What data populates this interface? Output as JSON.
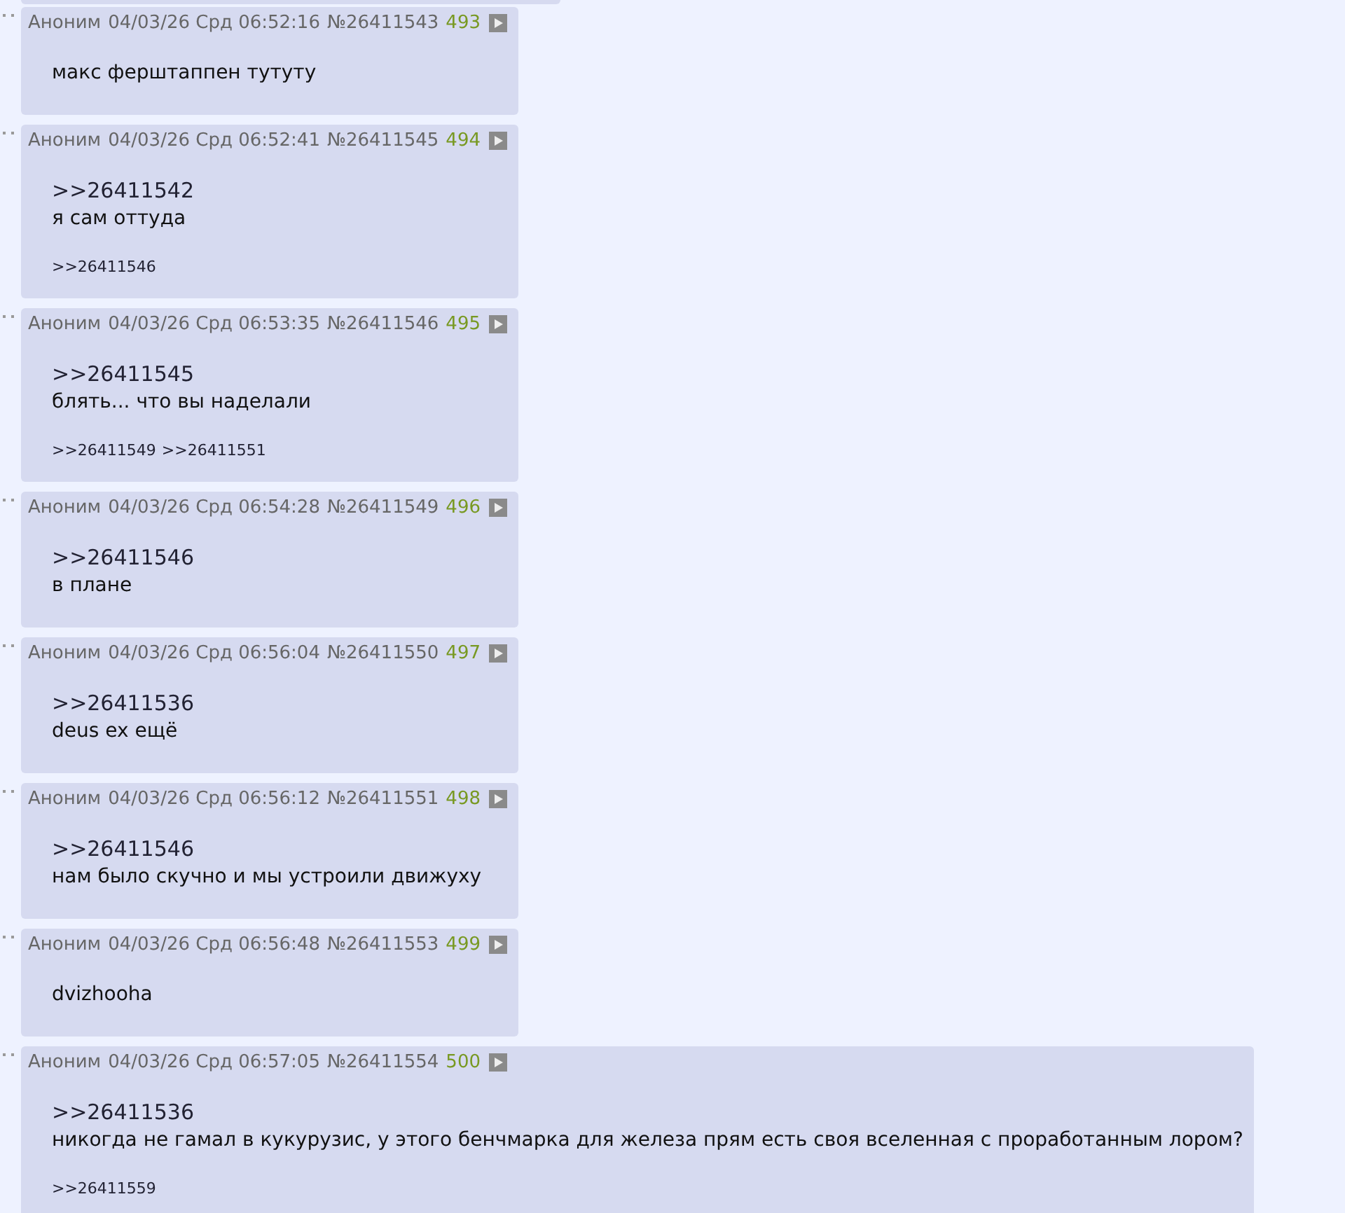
{
  "posts": [
    {
      "author": "Аноним",
      "date": "04/03/26 Срд 06:52:16",
      "number": "№26411543",
      "index": "493",
      "text": "макс ферштаппен тутуту"
    },
    {
      "author": "Аноним",
      "date": "04/03/26 Срд 06:52:41",
      "number": "№26411545",
      "index": "494",
      "quote": ">>26411542",
      "text": "я сам оттуда",
      "backlinks": [
        ">>26411546"
      ]
    },
    {
      "author": "Аноним",
      "date": "04/03/26 Срд 06:53:35",
      "number": "№26411546",
      "index": "495",
      "quote": ">>26411545",
      "text": "блять... что вы наделали",
      "backlinks": [
        ">>26411549",
        ">>26411551"
      ]
    },
    {
      "author": "Аноним",
      "date": "04/03/26 Срд 06:54:28",
      "number": "№26411549",
      "index": "496",
      "quote": ">>26411546",
      "text": "в плане"
    },
    {
      "author": "Аноним",
      "date": "04/03/26 Срд 06:56:04",
      "number": "№26411550",
      "index": "497",
      "quote": ">>26411536",
      "text": "deus ex ещё"
    },
    {
      "author": "Аноним",
      "date": "04/03/26 Срд 06:56:12",
      "number": "№26411551",
      "index": "498",
      "quote": ">>26411546",
      "text": "нам было скучно и мы устроили движуху"
    },
    {
      "author": "Аноним",
      "date": "04/03/26 Срд 06:56:48",
      "number": "№26411553",
      "index": "499",
      "text": "dvizhooha"
    },
    {
      "author": "Аноним",
      "date": "04/03/26 Срд 06:57:05",
      "number": "№26411554",
      "index": "500",
      "quote": ">>26411536",
      "text": "никогда не гамал в кукурузис, у этого бенчмарка для железа прям есть своя вселенная с проработанным лором?",
      "backlinks": [
        ">>26411559"
      ]
    }
  ]
}
